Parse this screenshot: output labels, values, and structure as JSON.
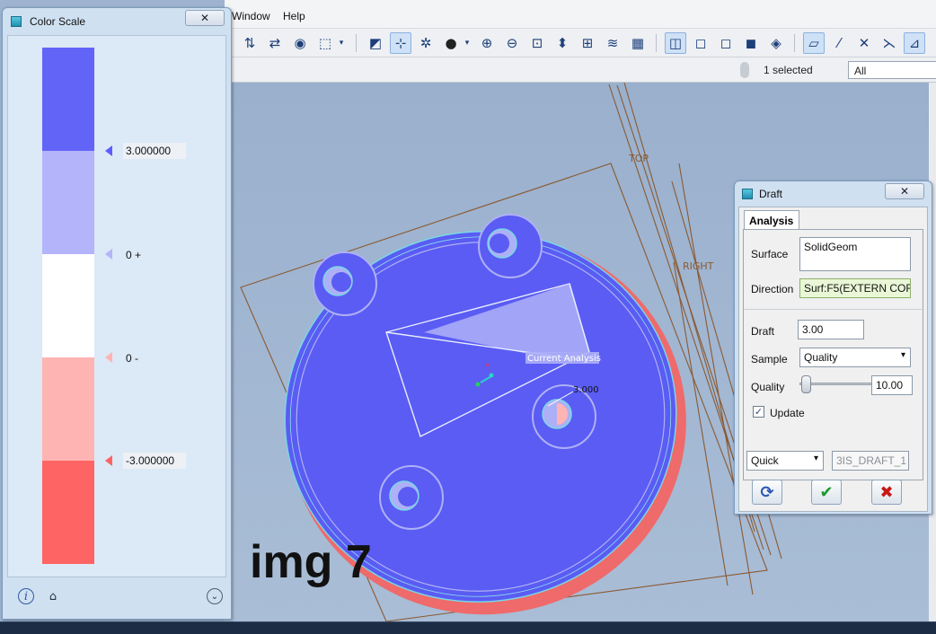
{
  "menubar": {
    "items": [
      "Window",
      "Help"
    ]
  },
  "toolbar": {
    "icons": [
      "regenerate-icon",
      "find-icon",
      "binoculars-icon",
      "select-box-icon",
      "saved-views-icon",
      "spin-center-icon",
      "annotation-icon",
      "shading-icon",
      "zoom-in-icon",
      "zoom-out-icon",
      "refit-icon",
      "reorient-icon",
      "view-manager-icon",
      "layers-icon",
      "appearance-icon",
      "wireframe-icon",
      "hidden-line-icon",
      "no-hidden-icon",
      "shaded-icon",
      "enhanced-realism-icon",
      "plane-display-icon",
      "axis-display-icon",
      "point-display-icon",
      "csys-display-icon",
      "annotation-display-icon"
    ]
  },
  "statusbar": {
    "selection_count": "1 selected",
    "filter_value": "All"
  },
  "viewport": {
    "datum_labels": [
      "TOP",
      "RIGHT"
    ],
    "analysis_tag": "Current Analysis",
    "value_tag": "3.000",
    "colors": {
      "part_blue": "#5a5cf3",
      "light_blue": "#aeb0f7",
      "edge_red": "#f06a6a",
      "datum_brown": "#8a5a32"
    }
  },
  "caption": "img 7",
  "color_scale": {
    "title": "Color Scale",
    "close_symbol": "✕",
    "bands": [
      "#6264f8",
      "#b4b4fb",
      "#ffffff",
      "#ffb4b4",
      "#ff6464"
    ],
    "markers": [
      {
        "label": "3.000000",
        "color": "#5d5dff"
      },
      {
        "label": "0 +",
        "color": "#b4b4fb"
      },
      {
        "label": "0 -",
        "color": "#ffb4b4"
      },
      {
        "label": "-3.000000",
        "color": "#ff6464"
      }
    ],
    "footer_icons": [
      "info-icon",
      "home-icon",
      "expand-icon"
    ]
  },
  "draft_dialog": {
    "title": "Draft",
    "close_symbol": "✕",
    "tab_label": "Analysis",
    "surface_label": "Surface",
    "surface_value": "SolidGeom",
    "direction_label": "Direction",
    "direction_value": "Surf:F5(EXTERN COF",
    "draft_label": "Draft",
    "draft_value": "3.00",
    "sample_label": "Sample",
    "sample_value": "Quality",
    "quality_label": "Quality",
    "quality_value": "10.00",
    "update_label": "Update",
    "update_checked": true,
    "mode_value": "Quick",
    "analysis_name": "3IS_DRAFT_1",
    "buttons": {
      "repeat_symbol": "⟳",
      "ok_symbol": "✔",
      "cancel_symbol": "✖"
    }
  }
}
